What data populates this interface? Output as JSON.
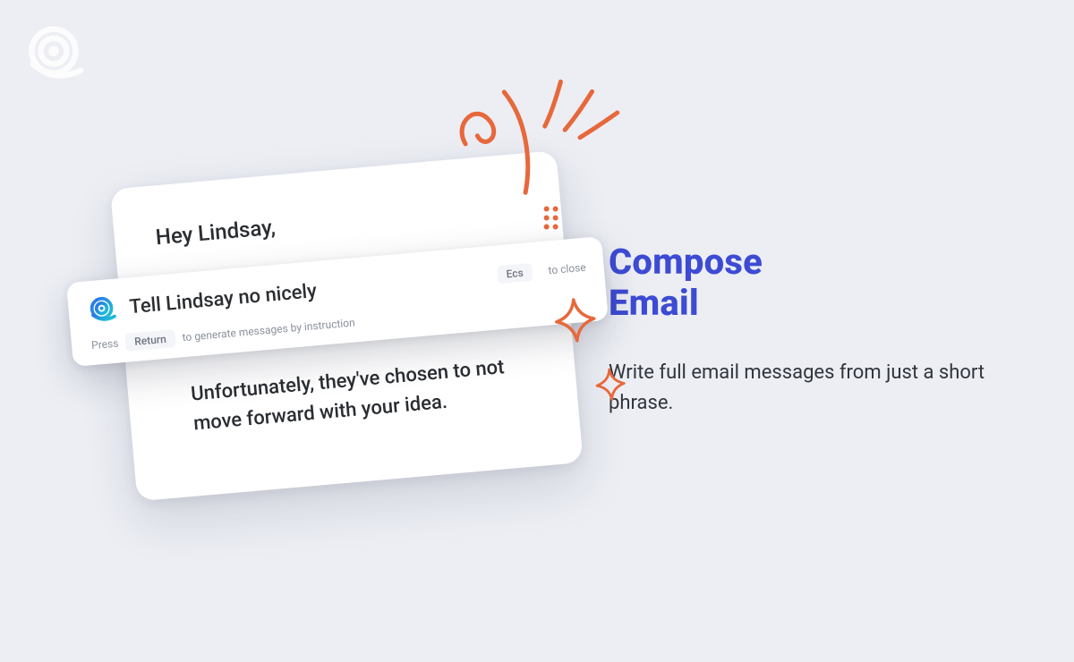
{
  "brand": {
    "accent": "#3d4bd4",
    "doodle": "#e7683b"
  },
  "right": {
    "headline_l1": "Compose",
    "headline_l2": "Email",
    "subtext": "Write full email messages from just a short phrase."
  },
  "card": {
    "greeting": "Hey Lindsay,",
    "body": "Unfortunately, they've chosen to not move forward with your idea."
  },
  "prompt": {
    "input_text": "Tell Lindsay no nicely",
    "close_key": "Ecs",
    "close_hint": "to close",
    "press_label": "Press",
    "return_key": "Return",
    "return_hint": "to generate messages by instruction"
  }
}
